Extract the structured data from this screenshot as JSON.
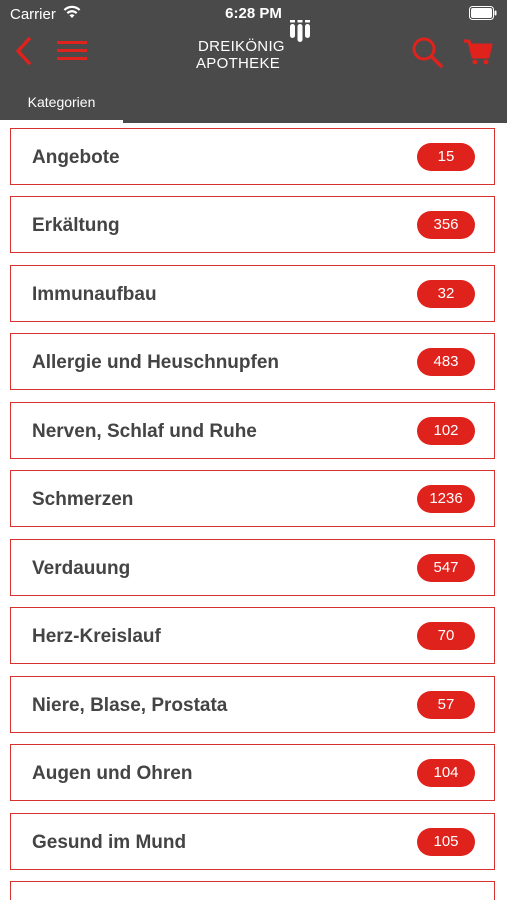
{
  "status_bar": {
    "carrier": "Carrier",
    "time": "6:28 PM"
  },
  "header": {
    "logo_line1": "DREIKÖNIG",
    "logo_line2": "APOTHEKE",
    "accent_color": "#e0221d",
    "background_color": "#4a4a4a"
  },
  "tabs": [
    {
      "label": "Kategorien",
      "active": true
    }
  ],
  "categories": [
    {
      "label": "Angebote",
      "count": "15"
    },
    {
      "label": "Erkältung",
      "count": "356"
    },
    {
      "label": "Immunaufbau",
      "count": "32"
    },
    {
      "label": "Allergie und Heuschnupfen",
      "count": "483"
    },
    {
      "label": "Nerven, Schlaf und Ruhe",
      "count": "102"
    },
    {
      "label": "Schmerzen",
      "count": "1236"
    },
    {
      "label": "Verdauung",
      "count": "547"
    },
    {
      "label": "Herz-Kreislauf",
      "count": "70"
    },
    {
      "label": "Niere, Blase, Prostata",
      "count": "57"
    },
    {
      "label": "Augen und Ohren",
      "count": "104"
    },
    {
      "label": "Gesund im Mund",
      "count": "105"
    },
    {
      "label": "",
      "count": ""
    }
  ]
}
